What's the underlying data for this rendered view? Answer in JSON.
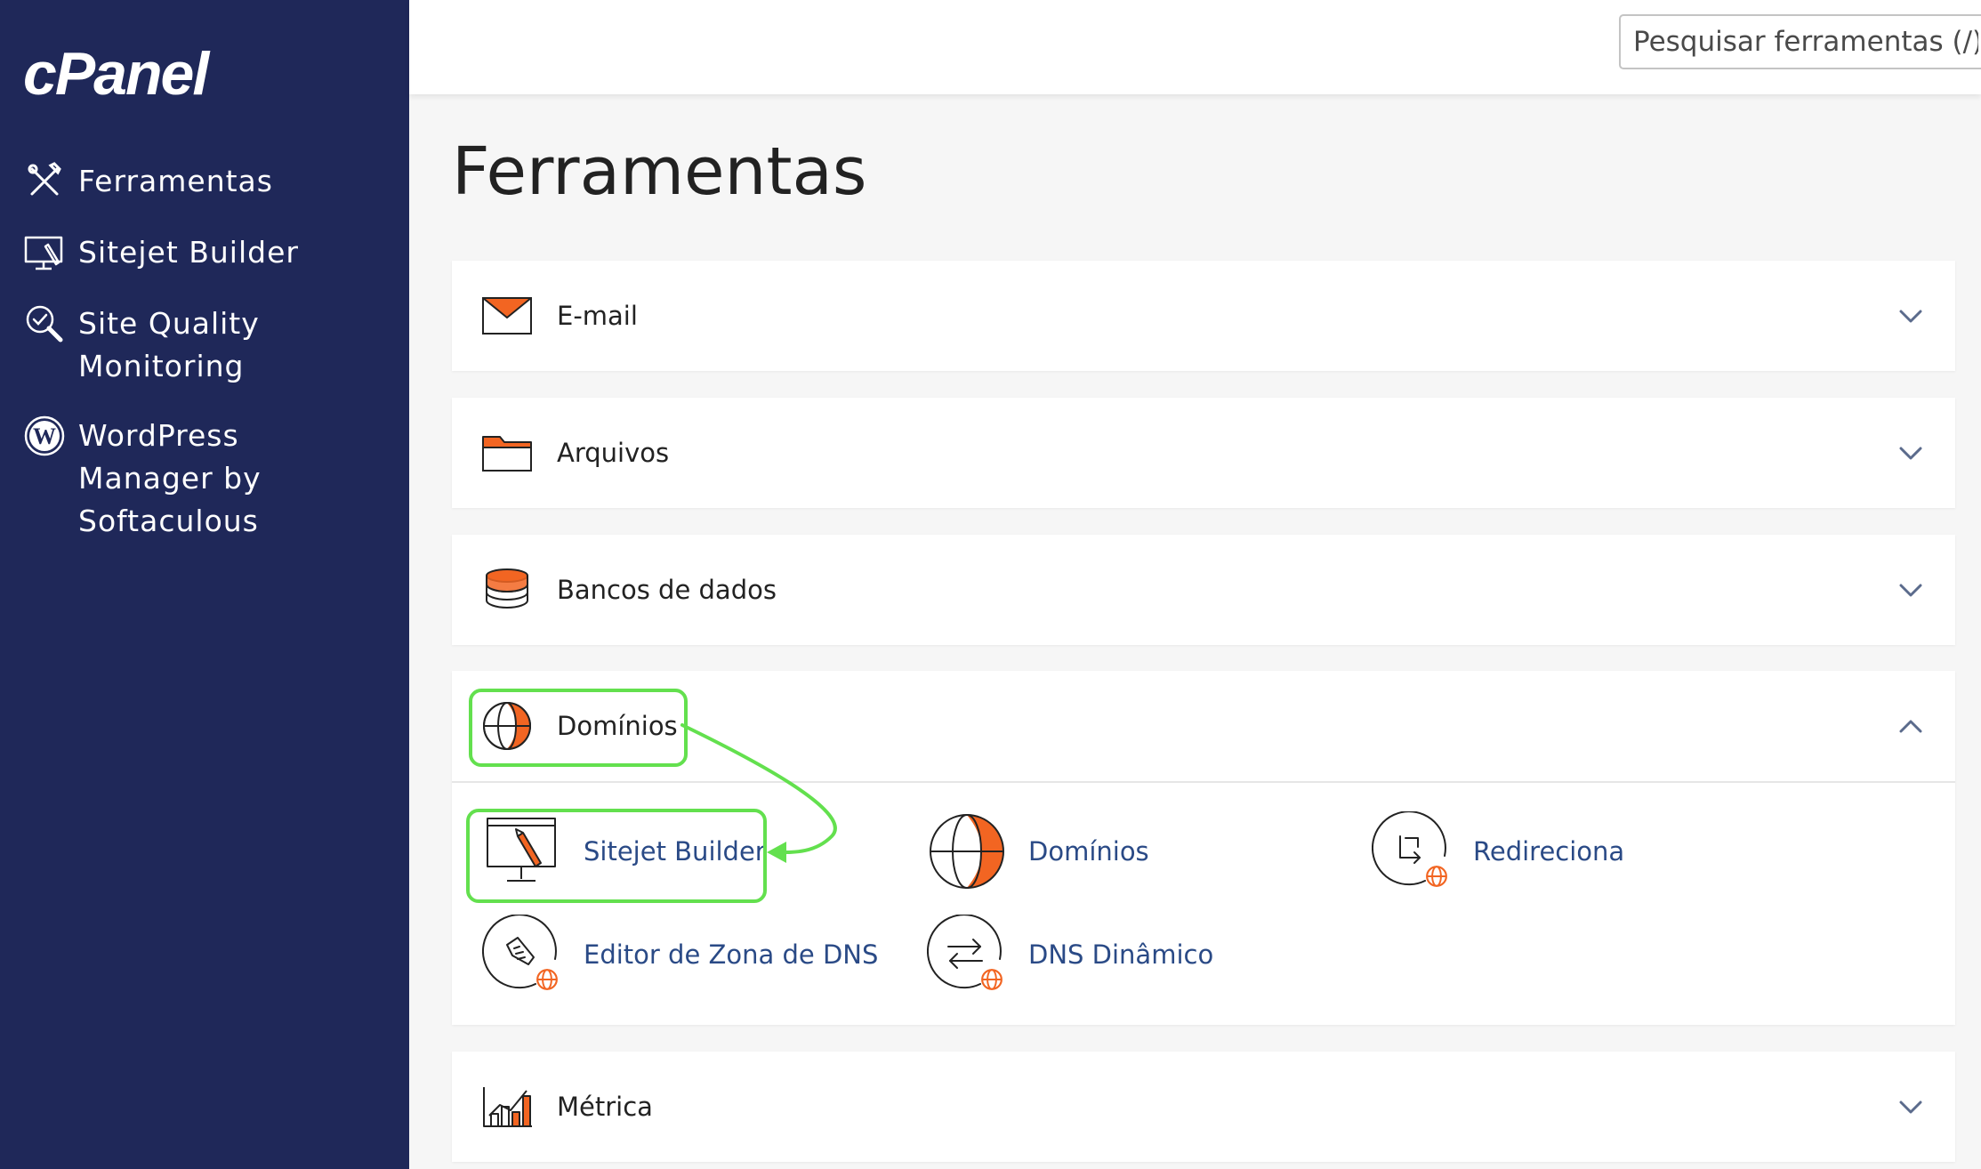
{
  "sidebar": {
    "logo": "cPanel",
    "items": [
      {
        "label": "Ferramentas",
        "icon": "tools-icon"
      },
      {
        "label": "Sitejet Builder",
        "icon": "monitor-brush-icon"
      },
      {
        "label": "Site Quality Monitoring",
        "icon": "magnifier-check-icon"
      },
      {
        "label": "WordPress Manager by Softaculous",
        "icon": "wordpress-icon"
      }
    ]
  },
  "header": {
    "search_placeholder": "Pesquisar ferramentas (/)"
  },
  "main": {
    "title": "Ferramentas",
    "sections": [
      {
        "title": "E-mail",
        "icon": "envelope-icon",
        "expanded": false
      },
      {
        "title": "Arquivos",
        "icon": "folder-icon",
        "expanded": false
      },
      {
        "title": "Bancos de dados",
        "icon": "database-icon",
        "expanded": false
      },
      {
        "title": "Domínios",
        "icon": "globe-icon",
        "expanded": true,
        "tools": [
          {
            "label": "Sitejet Builder",
            "icon": "monitor-brush-icon"
          },
          {
            "label": "Domínios",
            "icon": "globe-icon"
          },
          {
            "label": "Redireciona",
            "icon": "redirect-icon"
          },
          {
            "label": "Editor de Zona de DNS",
            "icon": "dns-zone-editor-icon"
          },
          {
            "label": "DNS Dinâmico",
            "icon": "dynamic-dns-icon"
          }
        ]
      },
      {
        "title": "Métrica",
        "icon": "bar-chart-icon",
        "expanded": false
      }
    ]
  },
  "colors": {
    "sidebar": "#1f2859",
    "accent": "#f26522",
    "link": "#2a4a86",
    "highlight": "#63e04e"
  }
}
